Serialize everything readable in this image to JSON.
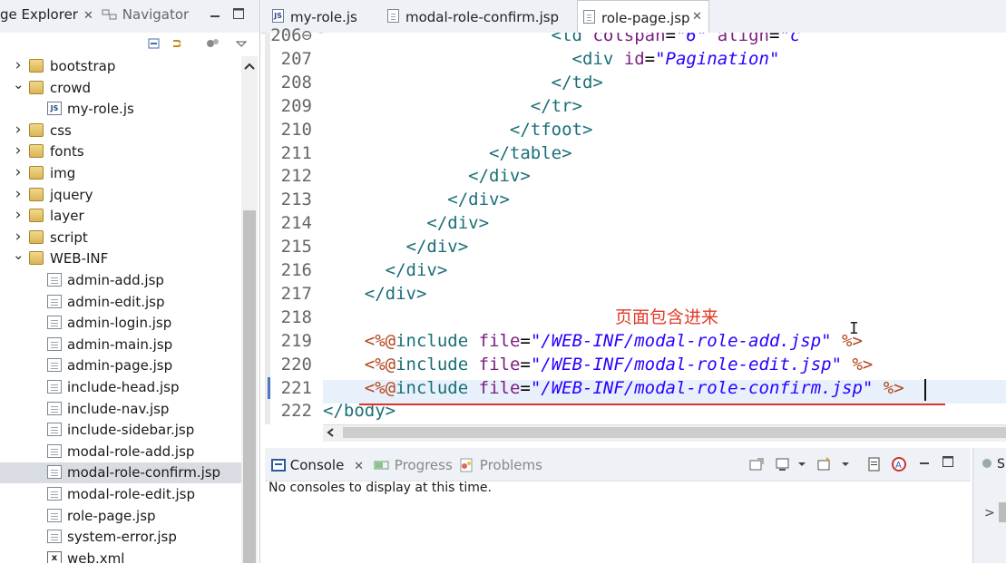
{
  "left_panel": {
    "tab_package_explorer": "ge Explorer",
    "tab_close": "✕",
    "tab_navigator": "Navigator",
    "tree": [
      {
        "label": "bootstrap",
        "type": "folder",
        "indent": 0,
        "expanded": false
      },
      {
        "label": "crowd",
        "type": "folder",
        "indent": 0,
        "expanded": true
      },
      {
        "label": "my-role.js",
        "type": "js",
        "indent": 1
      },
      {
        "label": "css",
        "type": "folder",
        "indent": 0,
        "expanded": false
      },
      {
        "label": "fonts",
        "type": "folder",
        "indent": 0,
        "expanded": false
      },
      {
        "label": "img",
        "type": "folder",
        "indent": 0,
        "expanded": false
      },
      {
        "label": "jquery",
        "type": "folder",
        "indent": 0,
        "expanded": false
      },
      {
        "label": "layer",
        "type": "folder",
        "indent": 0,
        "expanded": false
      },
      {
        "label": "script",
        "type": "folder",
        "indent": 0,
        "expanded": false
      },
      {
        "label": "WEB-INF",
        "type": "folder",
        "indent": 0,
        "expanded": true
      },
      {
        "label": "admin-add.jsp",
        "type": "file",
        "indent": 1
      },
      {
        "label": "admin-edit.jsp",
        "type": "file",
        "indent": 1
      },
      {
        "label": "admin-login.jsp",
        "type": "file",
        "indent": 1
      },
      {
        "label": "admin-main.jsp",
        "type": "file",
        "indent": 1
      },
      {
        "label": "admin-page.jsp",
        "type": "file",
        "indent": 1
      },
      {
        "label": "include-head.jsp",
        "type": "file",
        "indent": 1
      },
      {
        "label": "include-nav.jsp",
        "type": "file",
        "indent": 1
      },
      {
        "label": "include-sidebar.jsp",
        "type": "file",
        "indent": 1
      },
      {
        "label": "modal-role-add.jsp",
        "type": "file",
        "indent": 1
      },
      {
        "label": "modal-role-confirm.jsp",
        "type": "file",
        "indent": 1,
        "selected": true
      },
      {
        "label": "modal-role-edit.jsp",
        "type": "file",
        "indent": 1
      },
      {
        "label": "role-page.jsp",
        "type": "file",
        "indent": 1
      },
      {
        "label": "system-error.jsp",
        "type": "file",
        "indent": 1
      },
      {
        "label": "web.xml",
        "type": "xml",
        "indent": 1
      }
    ]
  },
  "editor": {
    "tabs": [
      {
        "label": "my-role.js",
        "active": false
      },
      {
        "label": "modal-role-confirm.jsp",
        "active": false
      },
      {
        "label": "role-page.jsp",
        "active": true,
        "close": "✕"
      }
    ],
    "lines": [
      {
        "num": "206⊖",
        "indent": "                      ",
        "html": "<span class=\"tag\">&lt;td</span> <span class=\"attr\">colspan</span>=<span class=\"str\">\"6\"</span> <span class=\"attr\">align</span>=<span class=\"str\">\"c</span>"
      },
      {
        "num": "207",
        "indent": "                        ",
        "html": "<span class=\"tag\">&lt;div</span> <span class=\"attr\">id</span>=<span class=\"str\">\"Pagination\"</span>"
      },
      {
        "num": "208",
        "indent": "                      ",
        "html": "<span class=\"tag\">&lt;/td&gt;</span>"
      },
      {
        "num": "209",
        "indent": "                    ",
        "html": "<span class=\"tag\">&lt;/tr&gt;</span>"
      },
      {
        "num": "210",
        "indent": "                  ",
        "html": "<span class=\"tag\">&lt;/tfoot&gt;</span>"
      },
      {
        "num": "211",
        "indent": "                ",
        "html": "<span class=\"tag\">&lt;/table&gt;</span>"
      },
      {
        "num": "212",
        "indent": "              ",
        "html": "<span class=\"tag\">&lt;/div&gt;</span>"
      },
      {
        "num": "213",
        "indent": "            ",
        "html": "<span class=\"tag\">&lt;/div&gt;</span>"
      },
      {
        "num": "214",
        "indent": "          ",
        "html": "<span class=\"tag\">&lt;/div&gt;</span>"
      },
      {
        "num": "215",
        "indent": "        ",
        "html": "<span class=\"tag\">&lt;/div&gt;</span>"
      },
      {
        "num": "216",
        "indent": "      ",
        "html": "<span class=\"tag\">&lt;/div&gt;</span>"
      },
      {
        "num": "217",
        "indent": "    ",
        "html": "<span class=\"tag\">&lt;/div&gt;</span>"
      },
      {
        "num": "218",
        "indent": "",
        "html": ""
      },
      {
        "num": "219",
        "indent": "    ",
        "html": "<span class=\"jsp\">&lt;%@</span><span class=\"tag\">include</span> <span class=\"attr\">file</span>=<span class=\"str\">\"/WEB-INF/modal-role-add.jsp\"</span> <span class=\"jsp\">%&gt;</span>"
      },
      {
        "num": "220",
        "indent": "    ",
        "html": "<span class=\"jsp\">&lt;%@</span><span class=\"tag\">include</span> <span class=\"attr\">file</span>=<span class=\"str\">\"/WEB-INF/modal-role-edit.jsp\"</span> <span class=\"jsp\">%&gt;</span>"
      },
      {
        "num": "221",
        "indent": "    ",
        "html": "<span class=\"jsp\">&lt;%@</span><span class=\"tag\">include</span> <span class=\"attr\">file</span>=<span class=\"str\">\"/WEB-INF/modal-role-confirm.jsp\"</span> <span class=\"jsp\">%&gt;</span>",
        "current": true
      },
      {
        "num": "222",
        "indent": "",
        "html": "<span class=\"tag\">&lt;/body&gt;</span>"
      }
    ],
    "annotation": "页面包含进来"
  },
  "bottom_panel": {
    "tab_console": "Console",
    "tab_close": "✕",
    "tab_progress": "Progress",
    "tab_problems": "Problems",
    "message": "No consoles to display at this time.",
    "right_tab_char": "S"
  }
}
